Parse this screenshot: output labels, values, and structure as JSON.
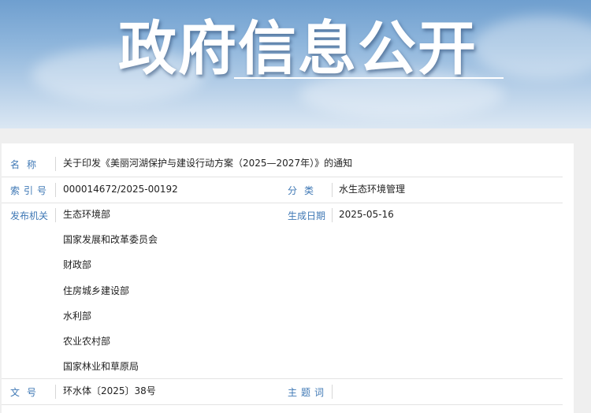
{
  "banner": {
    "title": "政府信息公开"
  },
  "doc": {
    "name_label": "名  称",
    "name_value": "关于印发《美丽河湖保护与建设行动方案（2025—2027年）》的通知",
    "index_label": "索引号",
    "index_value": "000014672/2025-00192",
    "category_label": "分  类",
    "category_value": "水生态环境管理",
    "issuer_label": "发布机关",
    "issuers": [
      "生态环境部",
      "国家发展和改革委员会",
      "财政部",
      "住房城乡建设部",
      "水利部",
      "农业农村部",
      "国家林业和草原局"
    ],
    "date_label": "生成日期",
    "date_value": "2025-05-16",
    "docno_label": "文  号",
    "docno_value": "环水体〔2025〕38号",
    "topic_label": "主题词",
    "topic_value": ""
  }
}
